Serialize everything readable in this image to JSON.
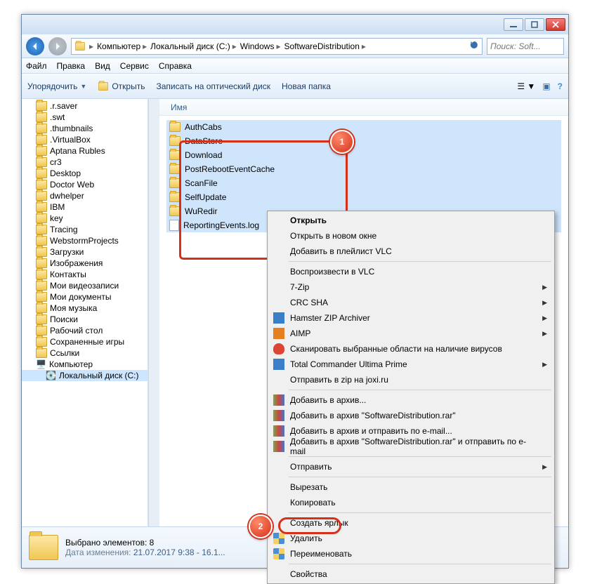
{
  "titlebar": {},
  "nav": {
    "breadcrumb": [
      {
        "label": "Компьютер"
      },
      {
        "label": "Локальный диск (C:)"
      },
      {
        "label": "Windows"
      },
      {
        "label": "SoftwareDistribution"
      }
    ],
    "search_placeholder": "Поиск: Soft..."
  },
  "menubar": [
    "Файл",
    "Правка",
    "Вид",
    "Сервис",
    "Справка"
  ],
  "toolbar": {
    "organize": "Упорядочить",
    "open": "Открыть",
    "burn": "Записать на оптический диск",
    "newfolder": "Новая папка"
  },
  "tree": [
    ".r.saver",
    ".swt",
    ".thumbnails",
    ".VirtualBox",
    "Aptana Rubles",
    "cr3",
    "Desktop",
    "Doctor Web",
    "dwhelper",
    "IBM",
    "key",
    "Tracing",
    "WebstormProjects",
    "Загрузки",
    "Изображения",
    "Контакты",
    "Мои видеозаписи",
    "Мои документы",
    "Моя музыка",
    "Поиски",
    "Рабочий стол",
    "Сохраненные игры",
    "Ссылки",
    "Компьютер",
    "Локальный диск (C:)"
  ],
  "content": {
    "column_header": "Имя",
    "items": [
      {
        "name": "AuthCabs",
        "type": "folder",
        "selected": true
      },
      {
        "name": "DataStore",
        "type": "folder",
        "selected": true
      },
      {
        "name": "Download",
        "type": "folder",
        "selected": true
      },
      {
        "name": "PostRebootEventCache",
        "type": "folder",
        "selected": true
      },
      {
        "name": "ScanFile",
        "type": "folder",
        "selected": true
      },
      {
        "name": "SelfUpdate",
        "type": "folder",
        "selected": true
      },
      {
        "name": "WuRedir",
        "type": "folder",
        "selected": true
      },
      {
        "name": "ReportingEvents.log",
        "type": "file",
        "selected": true
      }
    ]
  },
  "context_menu": [
    {
      "label": "Открыть",
      "bold": true
    },
    {
      "label": "Открыть в новом окне"
    },
    {
      "label": "Добавить в плейлист VLC"
    },
    {
      "sep": true
    },
    {
      "label": "Воспроизвести в VLC"
    },
    {
      "label": "7-Zip",
      "arrow": true
    },
    {
      "label": "CRC SHA",
      "arrow": true
    },
    {
      "label": "Hamster ZIP Archiver",
      "arrow": true,
      "icon": "bluebox"
    },
    {
      "label": "AIMP",
      "arrow": true,
      "icon": "orangebox"
    },
    {
      "label": "Сканировать выбранные области на наличие вирусов",
      "icon": "redhat"
    },
    {
      "label": "Total Commander Ultima Prime",
      "arrow": true,
      "icon": "bluebox"
    },
    {
      "label": "Отправить в zip на joxi.ru"
    },
    {
      "sep": true
    },
    {
      "label": "Добавить в архив...",
      "icon": "books"
    },
    {
      "label": "Добавить в архив \"SoftwareDistribution.rar\"",
      "icon": "books"
    },
    {
      "label": "Добавить в архив и отправить по e-mail...",
      "icon": "books"
    },
    {
      "label": "Добавить в архив \"SoftwareDistribution.rar\" и отправить по e-mail",
      "icon": "books"
    },
    {
      "sep": true
    },
    {
      "label": "Отправить",
      "arrow": true
    },
    {
      "sep": true
    },
    {
      "label": "Вырезать"
    },
    {
      "label": "Копировать"
    },
    {
      "sep": true
    },
    {
      "label": "Создать ярлык"
    },
    {
      "label": "Удалить",
      "icon": "shield"
    },
    {
      "label": "Переименовать",
      "icon": "shield"
    },
    {
      "sep": true
    },
    {
      "label": "Свойства"
    }
  ],
  "statusbar": {
    "selected_label": "Выбрано элементов: 8",
    "date_modified_label": "Дата изменения:",
    "date_modified": "21.07.2017 9:38 - 16.1..."
  },
  "annotations": {
    "b1": "1",
    "b2": "2"
  }
}
